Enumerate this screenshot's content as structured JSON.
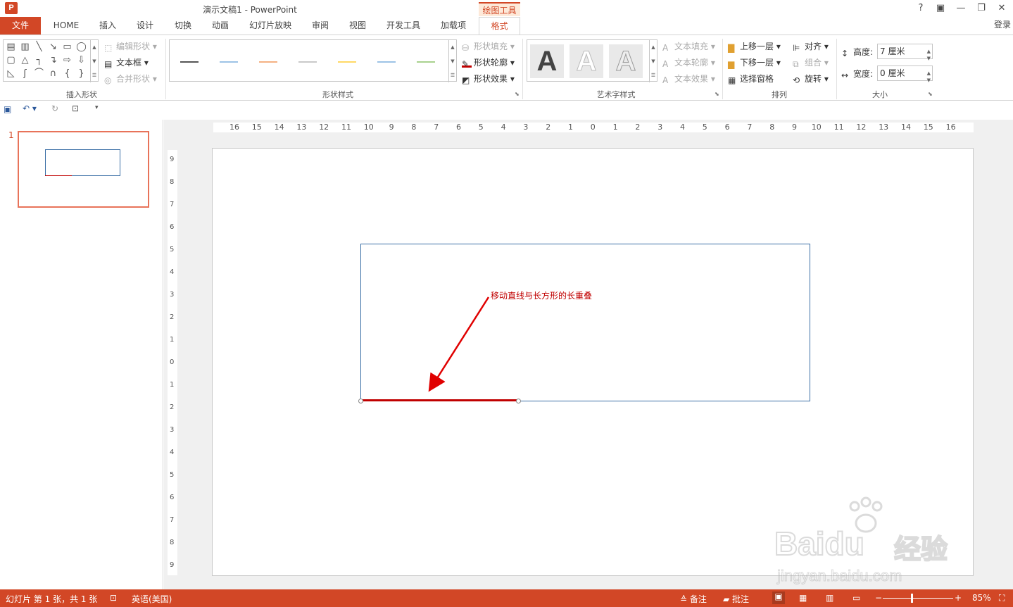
{
  "app": {
    "logo_letter": "P",
    "title": "演示文稿1 - PowerPoint",
    "help": "?",
    "login": "登录"
  },
  "tabs": {
    "file": "文件",
    "home": "HOME",
    "insert": "插入",
    "design": "设计",
    "transitions": "切换",
    "animations": "动画",
    "slideshow": "幻灯片放映",
    "review": "审阅",
    "view": "视图",
    "developer": "开发工具",
    "addins": "加载项",
    "format": "格式",
    "context": "绘图工具"
  },
  "ribbon": {
    "insert_shapes": {
      "label": "插入形状",
      "edit_shape": "编辑形状",
      "text_box": "文本框",
      "merge_shapes": "合并形状"
    },
    "shape_styles": {
      "label": "形状样式",
      "fill": "形状填充",
      "outline": "形状轮廓",
      "effects": "形状效果",
      "line_colors": [
        "#555555",
        "#9dc3e6",
        "#f4b183",
        "#c9c9c9",
        "#ffd966",
        "#9dc3e6",
        "#a9d18e"
      ]
    },
    "wordart": {
      "label": "艺术字样式",
      "letter": "A",
      "text_fill": "文本填充",
      "text_outline": "文本轮廓",
      "text_effects": "文本效果"
    },
    "arrange": {
      "label": "排列",
      "bring_forward": "上移一层",
      "send_backward": "下移一层",
      "selection_pane": "选择窗格",
      "align": "对齐",
      "group": "组合",
      "rotate": "旋转"
    },
    "size": {
      "label": "大小",
      "height_label": "高度:",
      "height_value": "7 厘米",
      "width_label": "宽度:",
      "width_value": "0 厘米"
    }
  },
  "thumbnail": {
    "number": "1"
  },
  "ruler": {
    "h": [
      "16",
      "15",
      "14",
      "13",
      "12",
      "11",
      "10",
      "9",
      "8",
      "7",
      "6",
      "5",
      "4",
      "3",
      "2",
      "1",
      "0",
      "1",
      "2",
      "3",
      "4",
      "5",
      "6",
      "7",
      "8",
      "9",
      "10",
      "11",
      "12",
      "13",
      "14",
      "15",
      "16"
    ],
    "v": [
      "9",
      "8",
      "7",
      "6",
      "5",
      "4",
      "3",
      "2",
      "1",
      "0",
      "1",
      "2",
      "3",
      "4",
      "5",
      "6",
      "7",
      "8",
      "9"
    ]
  },
  "slide": {
    "annotation": "移动直线与长方形的长重叠"
  },
  "status": {
    "slide_info": "幻灯片 第 1 张，共 1 张",
    "language": "英语(美国)",
    "notes": "备注",
    "comments": "批注",
    "zoom": "85%"
  },
  "watermark": {
    "brand": "Bai",
    "brand2": "du",
    "jy": "经验",
    "url": "jingyan.baidu.com"
  },
  "colors": {
    "accent": "#d24726",
    "line": "#c00000",
    "rect": "#3a6ea5"
  }
}
